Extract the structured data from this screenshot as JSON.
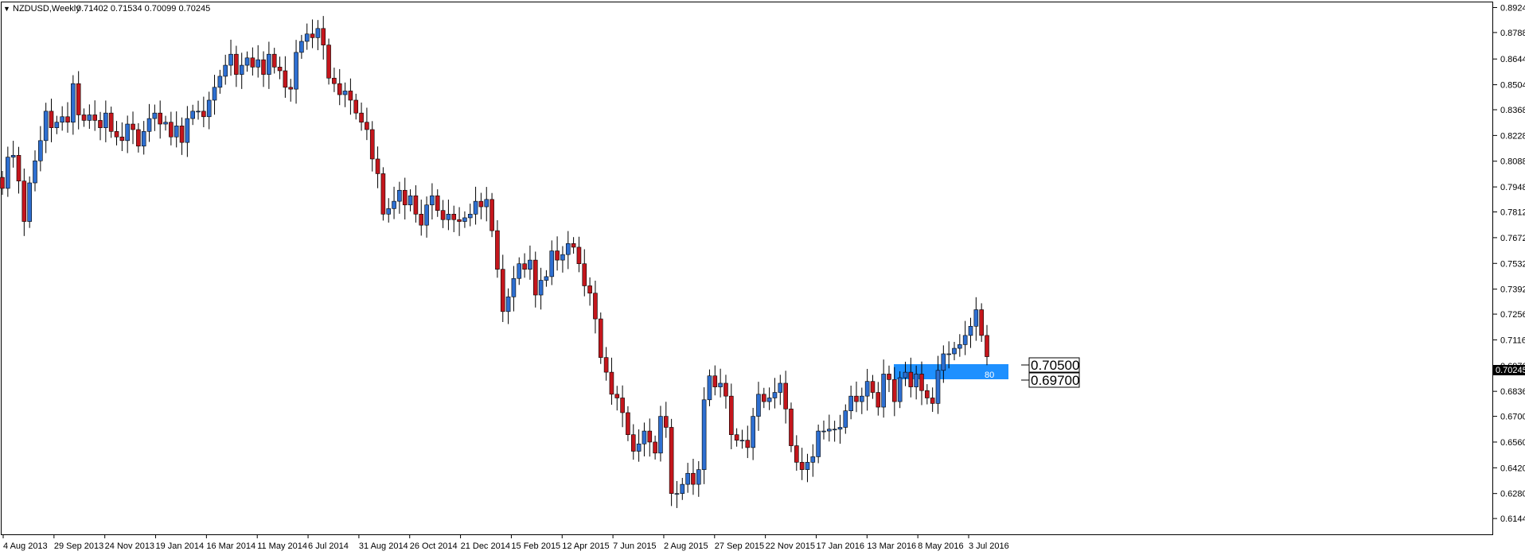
{
  "header": {
    "menu_glyph": "▼",
    "symbol": "NZDUSD,Weekly",
    "ohlc": "0.71402 0.71534 0.70099 0.70245"
  },
  "current_price_label": "0.70245",
  "zone": {
    "upper_label": "0.70500",
    "lower_label": "0.69700",
    "tag": "80",
    "color": "#1e90ff"
  },
  "colors": {
    "bull": "#2e6fd1",
    "bear": "#c4161c",
    "wick": "#000000",
    "background": "#ffffff"
  },
  "chart_data": {
    "type": "candlestick",
    "title": "NZDUSD,Weekly",
    "xlabel": "",
    "ylabel": "",
    "ylim": [
      0.6058,
      0.8952
    ],
    "grid": false,
    "y_ticks": [
      "0.89240",
      "0.87880",
      "0.86440",
      "0.85040",
      "0.83680",
      "0.82280",
      "0.80880",
      "0.79480",
      "0.78120",
      "0.76720",
      "0.75320",
      "0.73920",
      "0.72560",
      "0.71160",
      "0.69760",
      "0.68360",
      "0.67000",
      "0.65600",
      "0.64200",
      "0.62800",
      "0.61440"
    ],
    "x_ticks": [
      "4 Aug 2013",
      "29 Sep 2013",
      "24 Nov 2013",
      "19 Jan 2014",
      "16 Mar 2014",
      "11 May 2014",
      "6 Jul 2014",
      "31 Aug 2014",
      "26 Oct 2014",
      "21 Dec 2014",
      "15 Feb 2015",
      "12 Apr 2015",
      "7 Jun 2015",
      "2 Aug 2015",
      "27 Sep 2015",
      "22 Nov 2015",
      "17 Jan 2016",
      "13 Mar 2016",
      "8 May 2016",
      "3 Jul 2016"
    ],
    "close_series": [
      0.794,
      0.811,
      0.812,
      0.798,
      0.776,
      0.797,
      0.809,
      0.82,
      0.836,
      0.827,
      0.83,
      0.833,
      0.83,
      0.851,
      0.834,
      0.831,
      0.834,
      0.831,
      0.827,
      0.835,
      0.825,
      0.822,
      0.82,
      0.829,
      0.826,
      0.817,
      0.825,
      0.832,
      0.835,
      0.829,
      0.83,
      0.822,
      0.828,
      0.819,
      0.832,
      0.836,
      0.836,
      0.833,
      0.842,
      0.849,
      0.855,
      0.861,
      0.867,
      0.856,
      0.861,
      0.865,
      0.86,
      0.864,
      0.856,
      0.867,
      0.86,
      0.858,
      0.849,
      0.848,
      0.868,
      0.874,
      0.878,
      0.876,
      0.881,
      0.872,
      0.854,
      0.851,
      0.845,
      0.847,
      0.842,
      0.835,
      0.83,
      0.826,
      0.81,
      0.802,
      0.78,
      0.783,
      0.787,
      0.793,
      0.785,
      0.79,
      0.78,
      0.774,
      0.785,
      0.79,
      0.782,
      0.777,
      0.78,
      0.777,
      0.776,
      0.778,
      0.78,
      0.787,
      0.784,
      0.788,
      0.771,
      0.75,
      0.727,
      0.735,
      0.745,
      0.753,
      0.75,
      0.755,
      0.736,
      0.744,
      0.746,
      0.76,
      0.755,
      0.758,
      0.764,
      0.762,
      0.753,
      0.741,
      0.737,
      0.723,
      0.702,
      0.694,
      0.682,
      0.68,
      0.672,
      0.66,
      0.651,
      0.655,
      0.662,
      0.656,
      0.65,
      0.67,
      0.664,
      0.628,
      0.628,
      0.633,
      0.639,
      0.633,
      0.641,
      0.679,
      0.692,
      0.686,
      0.688,
      0.681,
      0.66,
      0.657,
      0.657,
      0.653,
      0.67,
      0.682,
      0.678,
      0.68,
      0.683,
      0.688,
      0.674,
      0.654,
      0.645,
      0.641,
      0.645,
      0.648,
      0.662,
      0.662,
      0.663,
      0.663,
      0.664,
      0.673,
      0.681,
      0.678,
      0.681,
      0.689,
      0.683,
      0.675,
      0.693,
      0.69,
      0.678,
      0.691,
      0.694,
      0.686,
      0.693,
      0.684,
      0.68,
      0.677,
      0.695,
      0.704,
      0.704,
      0.707,
      0.709,
      0.714,
      0.719,
      0.728,
      0.714,
      0.70245
    ]
  }
}
